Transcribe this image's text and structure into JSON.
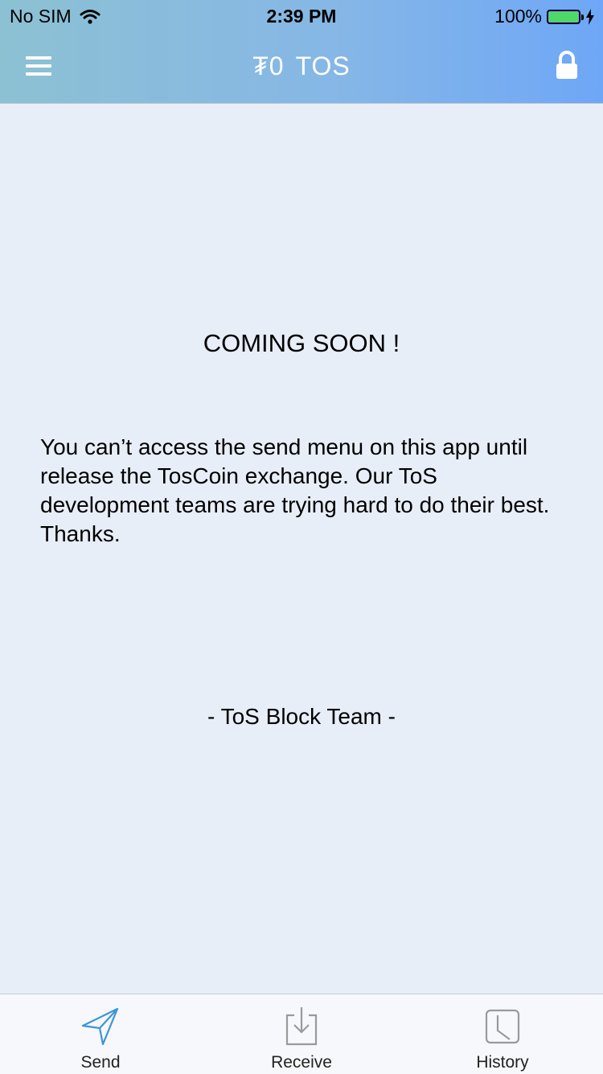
{
  "status_bar": {
    "carrier": "No SIM",
    "time": "2:39 PM",
    "battery": "100%",
    "battery_level": 1.0,
    "icons": [
      "wifi-icon",
      "battery-icon",
      "charging-bolt-icon"
    ]
  },
  "nav": {
    "currency_symbol": "₮0",
    "currency_code": "TOS",
    "icons": [
      "hamburger-menu-icon",
      "lock-icon"
    ]
  },
  "content": {
    "heading": "COMING SOON !",
    "message": "You can’t access the send menu on this app until release the TosCoin exchange. Our ToS development teams are trying hard to do their best. Thanks.",
    "signature": "- ToS Block Team -"
  },
  "tabs": [
    {
      "label": "Send",
      "icon": "send-icon",
      "active": true
    },
    {
      "label": "Receive",
      "icon": "receive-icon",
      "active": false
    },
    {
      "label": "History",
      "icon": "history-icon",
      "active": false
    }
  ],
  "colors": {
    "header_gradient_start": "#8cc1d3",
    "header_gradient_end": "#6ea7f7",
    "background": "#e8eef7",
    "active_tab_icon": "#3e95d6",
    "inactive_tab_icon": "#9a9a9a",
    "battery_fill": "#4cd964"
  }
}
